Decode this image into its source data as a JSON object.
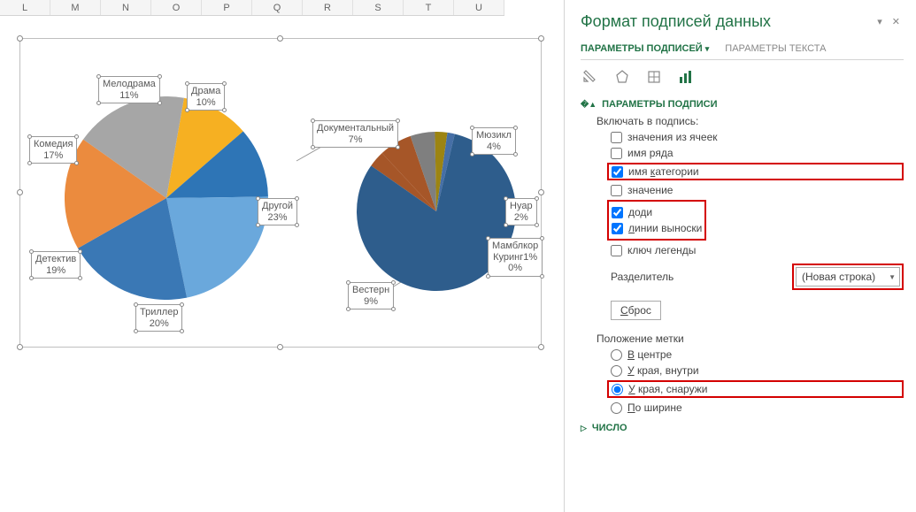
{
  "columns": [
    "L",
    "M",
    "N",
    "O",
    "P",
    "Q",
    "R",
    "S",
    "T",
    "U"
  ],
  "chart_data": [
    {
      "type": "pie",
      "series": [
        {
          "label": "Мелодрама",
          "pct": 11,
          "color": "#f6b022"
        },
        {
          "label": "Драма",
          "pct": 10,
          "color": "#2e75b6"
        },
        {
          "label": "Другой",
          "pct": 23,
          "color": "#6aa8dc"
        },
        {
          "label": "Триллер",
          "pct": 20,
          "color": "#3a78b5"
        },
        {
          "label": "Детектив",
          "pct": 19,
          "color": "#eb8b3e"
        },
        {
          "label": "Комедия",
          "pct": 17,
          "color": "#a6a6a6"
        }
      ]
    },
    {
      "type": "pie",
      "series": [
        {
          "label": "Документальный",
          "pct": 7,
          "color": "#a65628"
        },
        {
          "label": "Мюзикл",
          "pct": 4,
          "color": "#7f7f7f"
        },
        {
          "label": "Нуар",
          "pct": 2,
          "color": "#9c8412"
        },
        {
          "label": "Мамблкор",
          "pct": 1,
          "color": "#466fa6"
        },
        {
          "label": "Куринг",
          "pct": 0,
          "color": "#2e5d8c"
        },
        {
          "label": "Вестерн",
          "pct": 9,
          "color": "#2e5d8c"
        }
      ],
      "remainder_color": "#2e5d8c"
    }
  ],
  "panel": {
    "title": "Формат подписей данных",
    "tab_options": "ПАРАМЕТРЫ ПОДПИСЕЙ",
    "tab_text": "ПАРАМЕТРЫ ТЕКСТА",
    "section_options": "ПАРАМЕТРЫ ПОДПИСИ",
    "include_label": "Включать в подпись:",
    "chk_cells": "значения из ячеек",
    "chk_series": "имя ряда",
    "chk_category": "имя категории",
    "chk_value": "значение",
    "chk_pct": "доди",
    "chk_leader": "линии выноски",
    "chk_legend_key": "ключ легенды",
    "separator_label": "Разделитель",
    "separator_value": "(Новая строка)",
    "reset_btn": "Сброс",
    "position_label": "Положение метки",
    "pos_center": "В центре",
    "pos_inside_end": "У края, внутри",
    "pos_outside_end": "У края, снаружи",
    "pos_best_fit": "По ширине",
    "section_number": "ЧИСЛО"
  }
}
